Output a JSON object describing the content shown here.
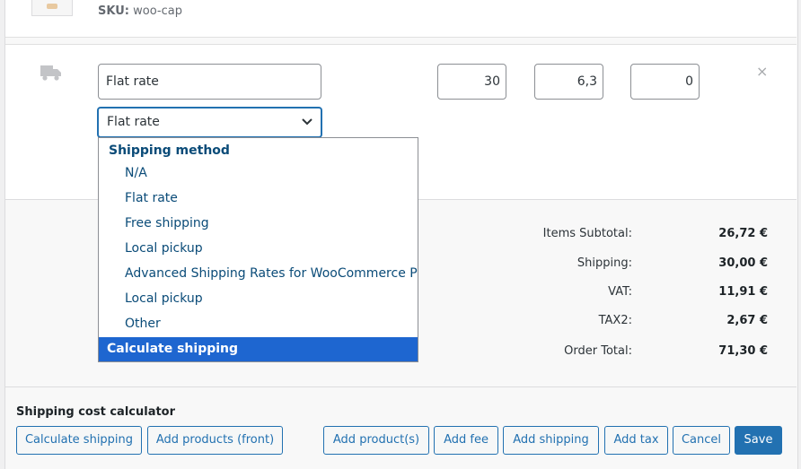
{
  "product": {
    "sku_label": "SKU:",
    "sku_value": "woo-cap"
  },
  "shipping_item": {
    "name_value": "Flat rate",
    "cost": "30",
    "tax1": "6,3",
    "tax2": "0",
    "remove_icon": "×",
    "method_select": {
      "selected_label": "Flat rate",
      "group_label": "Shipping method",
      "options": [
        "N/A",
        "Flat rate",
        "Free shipping",
        "Local pickup",
        "Advanced Shipping Rates for WooCommerce Pro",
        "Local pickup",
        "Other"
      ],
      "highlighted_option": "Calculate shipping"
    }
  },
  "totals": {
    "rows": [
      {
        "label": "Items Subtotal:",
        "value": "26,72 €"
      },
      {
        "label": "Shipping:",
        "value": "30,00 €"
      },
      {
        "label": "VAT:",
        "value": "11,91 €"
      },
      {
        "label": "TAX2:",
        "value": "2,67 €"
      },
      {
        "label": "Order Total:",
        "value": "71,30 €"
      }
    ]
  },
  "calculator": {
    "title": "Shipping cost calculator",
    "calculate_label": "Calculate shipping",
    "add_front_label": "Add products (front)"
  },
  "actions": {
    "add_products_label": "Add product(s)",
    "add_fee_label": "Add fee",
    "add_shipping_label": "Add shipping",
    "add_tax_label": "Add tax",
    "cancel_label": "Cancel",
    "save_label": "Save"
  },
  "colors": {
    "accent": "#2271b1",
    "highlight": "#1e66d0",
    "link_text": "#0a4b78"
  }
}
